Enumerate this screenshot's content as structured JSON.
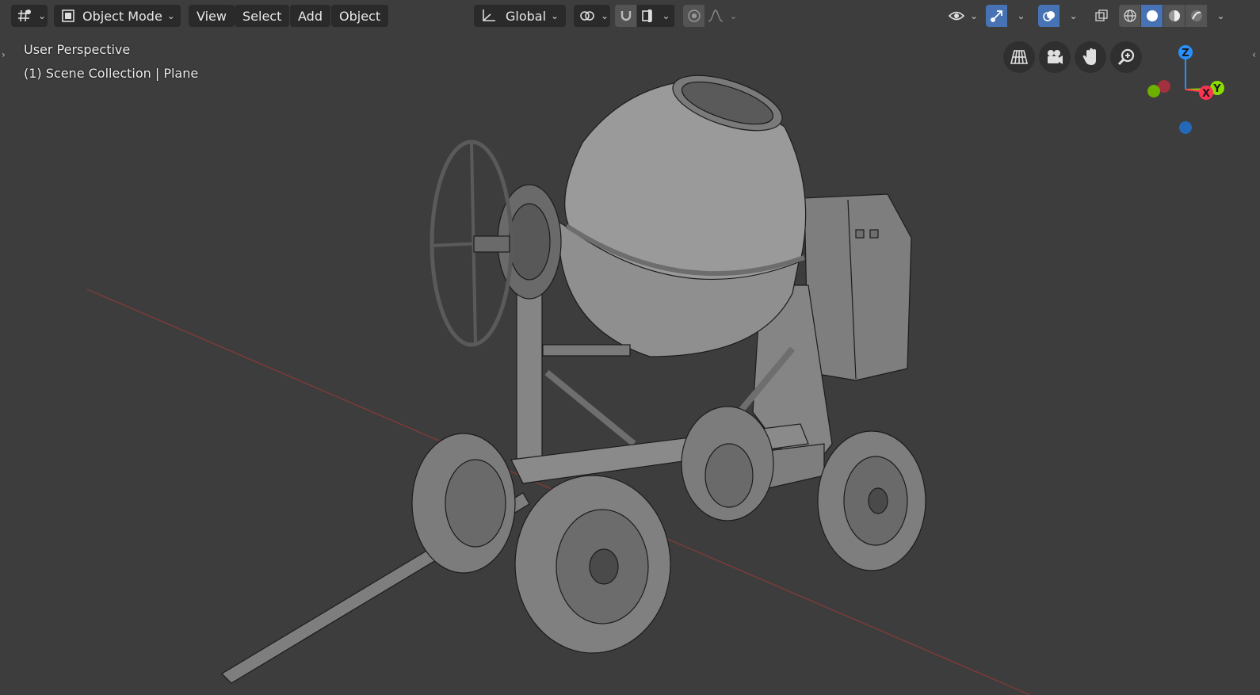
{
  "header": {
    "editor_type_icon": "viewport-editor-icon",
    "mode": {
      "label": "Object Mode",
      "icon": "object-mode-icon"
    },
    "menus": [
      "View",
      "Select",
      "Add",
      "Object"
    ],
    "transform_orientation": {
      "label": "Global",
      "icon": "orientation-gizmo-icon"
    },
    "pivot_icon": "pivot-point-icon",
    "snap_icon": "magnet-snap-icon",
    "snap_target_icon": "snap-target-icon",
    "proportional_icon": "proportional-edit-icon",
    "falloff_icon": "falloff-curve-icon",
    "visibility_icon": "eye-visibility-icon",
    "gizmo_icon": "gizmo-toggle-icon",
    "overlay_icon": "overlays-icon",
    "xray_icon": "xray-toggle-icon",
    "shading_modes": [
      "wireframe-shading-icon",
      "solid-shading-icon",
      "material-shading-icon",
      "rendered-shading-icon"
    ],
    "active_shading": "solid-shading-icon"
  },
  "overlay": {
    "view_name": "User Perspective",
    "collection_info": "(1) Scene Collection | Plane"
  },
  "nav_buttons": [
    "toggle-perspective-icon",
    "camera-view-icon",
    "pan-hand-icon",
    "zoom-magnifier-icon"
  ],
  "axis_gizmo": {
    "z": "Z",
    "y": "Y",
    "x": "X"
  },
  "colors": {
    "viewport_bg": "#3d3d3d",
    "active_blue": "#4772b3",
    "axis_x": "#ff3352",
    "axis_y": "#8bdc00",
    "axis_z": "#2890ff"
  }
}
